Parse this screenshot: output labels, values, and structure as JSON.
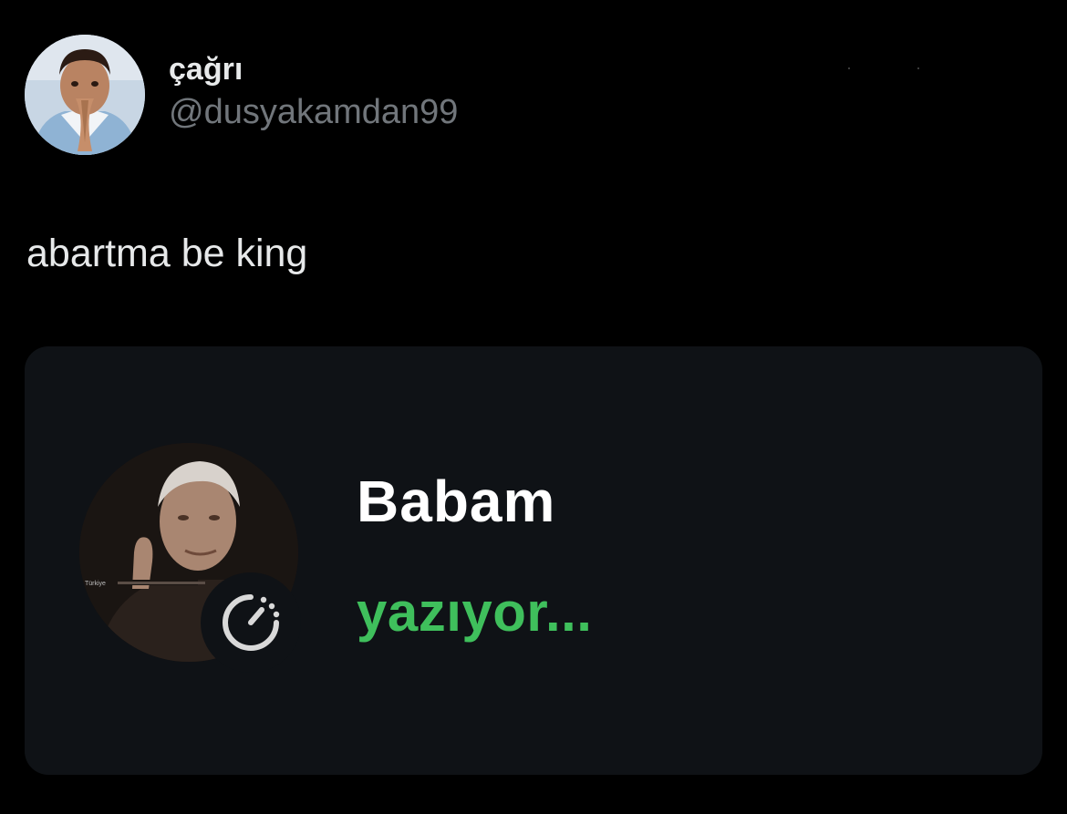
{
  "tweet": {
    "author": {
      "display_name": "çağrı",
      "handle": "@dusyakamdan99"
    },
    "text": "abartma be king",
    "media": {
      "contact_name": "Babam",
      "status": "yazıyor...",
      "avatar_watermark": "Türkiye"
    }
  },
  "colors": {
    "background": "#000000",
    "card_background": "#0f1216",
    "primary_text": "#e7e9ea",
    "secondary_text": "#71767b",
    "typing_green": "#3fbf5c"
  },
  "icons": {
    "timer": "disappearing-messages-timer-icon"
  }
}
